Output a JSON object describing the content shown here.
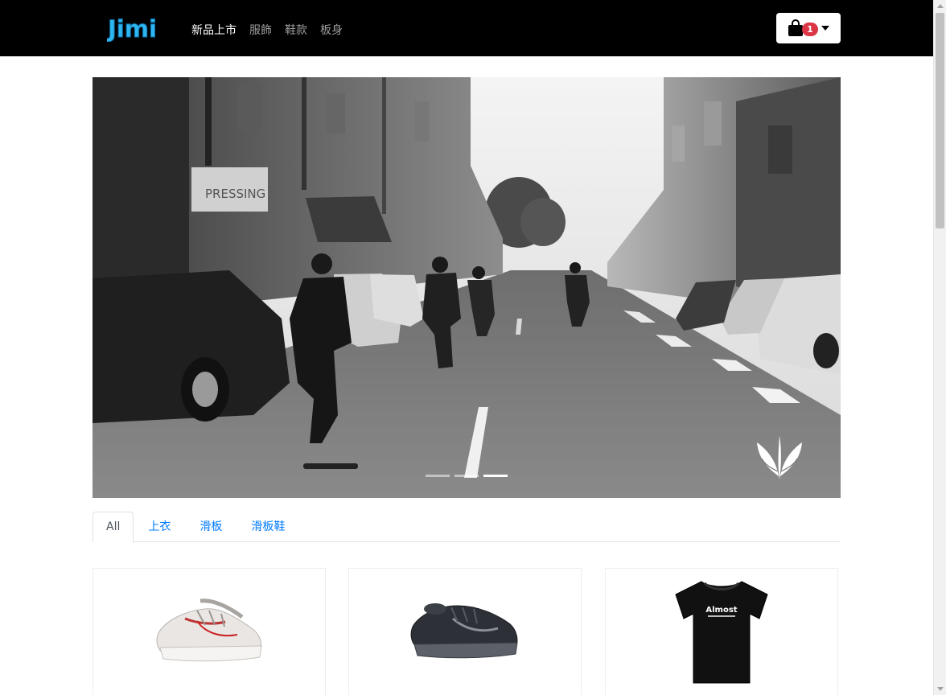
{
  "brand": {
    "logo_text": "Jimi",
    "logo_color": "#2fb6ee"
  },
  "nav": {
    "links": [
      {
        "label": "新品上市",
        "active": true
      },
      {
        "label": "服飾",
        "active": false
      },
      {
        "label": "鞋款",
        "active": false
      },
      {
        "label": "板身",
        "active": false
      }
    ]
  },
  "cart": {
    "icon": "shopping-bag-icon",
    "count": "1",
    "badge_color": "#dc3545"
  },
  "carousel": {
    "slides_count": 3,
    "active_slide": 3,
    "brand_icon": "leaf-logo-icon",
    "sign_pressing": "PRESSING"
  },
  "tabs": [
    {
      "label": "All",
      "active": true
    },
    {
      "label": "上衣",
      "active": false
    },
    {
      "label": "滑板",
      "active": false
    },
    {
      "label": "滑板鞋",
      "active": false
    }
  ],
  "products": [
    {
      "image": "white-sneaker-image"
    },
    {
      "image": "black-sneaker-image"
    },
    {
      "image": "black-tshirt-image",
      "print_text": "Almost"
    }
  ]
}
